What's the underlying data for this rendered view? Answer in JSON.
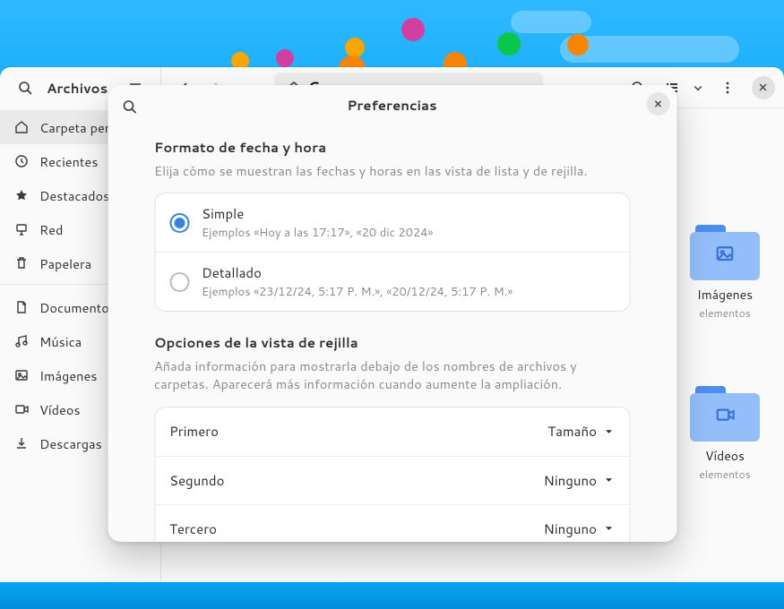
{
  "sky": {},
  "file_manager": {
    "app_title": "Archivos",
    "path_prefix": "C",
    "folders_right": [
      {
        "label": "Imágenes",
        "meta": "elementos"
      },
      {
        "label": "Vídeos",
        "meta": "elementos"
      }
    ]
  },
  "sidebar": {
    "items": [
      {
        "icon": "home",
        "label": "Carpeta personal",
        "selected": true
      },
      {
        "icon": "clock",
        "label": "Recientes"
      },
      {
        "icon": "star",
        "label": "Destacados"
      },
      {
        "icon": "net",
        "label": "Red"
      },
      {
        "icon": "trash",
        "label": "Papelera"
      }
    ],
    "items2": [
      {
        "icon": "doc",
        "label": "Documentos"
      },
      {
        "icon": "music",
        "label": "Música"
      },
      {
        "icon": "image",
        "label": "Imágenes"
      },
      {
        "icon": "video",
        "label": "Vídeos"
      },
      {
        "icon": "down",
        "label": "Descargas"
      }
    ]
  },
  "modal": {
    "title": "Preferencias",
    "section1": {
      "title": "Formato de fecha y hora",
      "desc": "Elija cómo se muestran las fechas y horas en las vista de lista y de rejilla.",
      "options": [
        {
          "label": "Simple",
          "sub": "Ejemplos «Hoy a las 17:17», «20 dic 2024»",
          "selected": true
        },
        {
          "label": "Detallado",
          "sub": "Ejemplos «23/12/24, 5:17 P. M.», «20/12/24, 5:17 P. M.»",
          "selected": false
        }
      ]
    },
    "section2": {
      "title": "Opciones de la vista de rejilla",
      "desc": "Añada información para mostrarla debajo de los nombres de archivos y carpetas. Aparecerá más información cuando aumente la ampliación.",
      "rows": [
        {
          "label": "Primero",
          "value": "Tamaño"
        },
        {
          "label": "Segundo",
          "value": "Ninguno"
        },
        {
          "label": "Tercero",
          "value": "Ninguno"
        }
      ]
    }
  }
}
